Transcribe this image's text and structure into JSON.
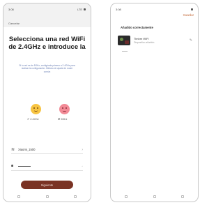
{
  "left_screen": {
    "status_time": "3:08",
    "status_right": "LTE",
    "cancel_label": "Cancelar",
    "headline": "Selecciona una red WiFi de 2.4GHz e introduce la",
    "description": "Si tu red es de 5GHz, configúrala primero a 2.4GHz para realizar la configuración. Método de ajuste de router común",
    "band_24_label": "2.4Ghz",
    "band_5_label": "5Ghz",
    "wifi_name": "Xiaomi_1500",
    "password_placeholder": "••••••••",
    "next_button": "Siguiente"
  },
  "right_screen": {
    "status_time": "3:08",
    "done_label": "Guardar",
    "section_title": "Añadido correctamente",
    "device_name": "Timbre WiFi",
    "device_status": "Dispositivo añadido"
  }
}
